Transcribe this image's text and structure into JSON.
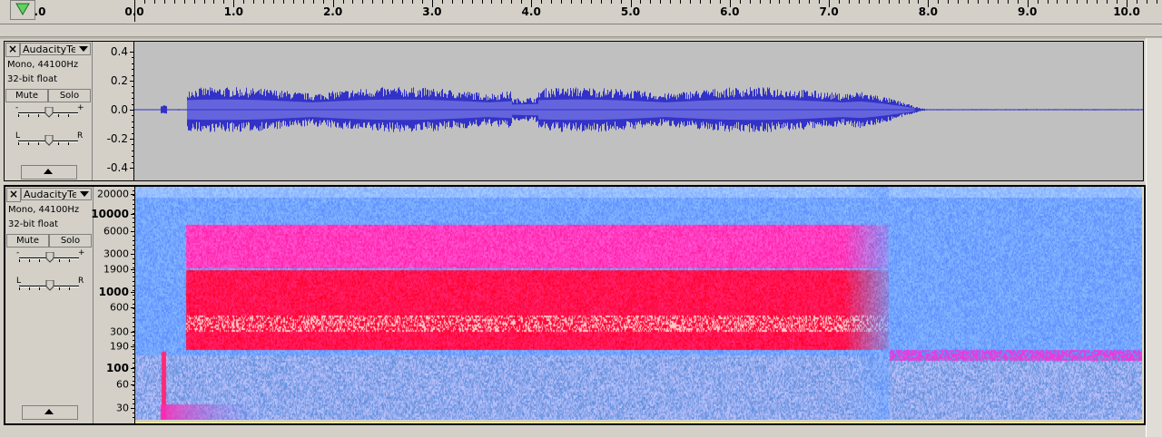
{
  "ruler": {
    "ticks": [
      "0.0",
      "1.0",
      "2.0",
      "3.0",
      "4.0",
      "5.0",
      "6.0",
      "7.0",
      "8.0",
      "9.0",
      "10.0"
    ],
    "left_partial": ".0",
    "play_head_icon": "green-triangle-down-icon"
  },
  "tracks": [
    {
      "name": "AudacityTe",
      "info_line1": "Mono, 44100Hz",
      "info_line2": "32-bit float",
      "mute_label": "Mute",
      "solo_label": "Solo",
      "gain_minus": "-",
      "gain_plus": "+",
      "pan_left": "L",
      "pan_right": "R",
      "view": "waveform",
      "scale_labels": [
        "0.4",
        "0.2",
        "0.0",
        "-0.2",
        "-0.4"
      ],
      "waveform_color": "#3232c8"
    },
    {
      "name": "AudacityTe",
      "info_line1": "Mono, 44100Hz",
      "info_line2": "32-bit float",
      "mute_label": "Mute",
      "solo_label": "Solo",
      "gain_minus": "-",
      "gain_plus": "+",
      "pan_left": "L",
      "pan_right": "R",
      "view": "spectrogram",
      "scale_labels": [
        "20000",
        "10000",
        "6000",
        "3000",
        "1900",
        "1000",
        "600",
        "300",
        "190",
        "100",
        "60",
        "30"
      ]
    }
  ],
  "colors": {
    "background": "#d4d0c8",
    "wave_bg": "#c0c0c0",
    "selected_track_border": "#ffff80",
    "spec_low": "#6fa0ff",
    "spec_mid": "#ff2ca8",
    "spec_high": "#ff1a1a"
  }
}
